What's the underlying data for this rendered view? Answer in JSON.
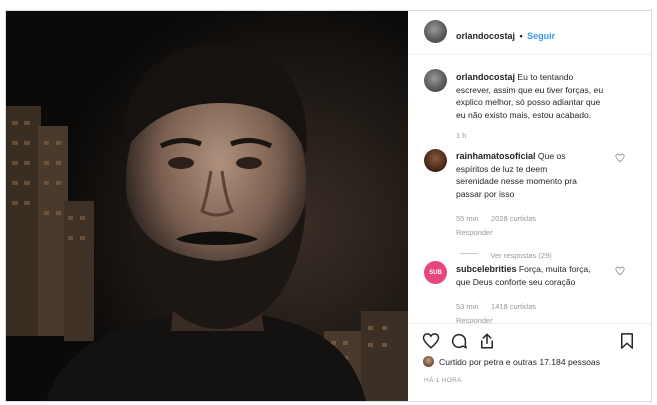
{
  "post": {
    "author": "orlandocostaj",
    "follow_label": "Seguir",
    "separator": "•"
  },
  "caption": {
    "author": "orlandocostaj",
    "text_lines": [
      "Eu to tentando",
      "escrever, assim que eu tiver forças, eu",
      "explico melhor, só posso adiantar que",
      "eu não existo mais, estou acabado."
    ],
    "time": "1 h"
  },
  "comments": [
    {
      "author": "rainhamatosoficial",
      "text_lines": [
        "Que os",
        "espíritos de luz te deem",
        "serenidade nesse momento pra",
        "passar por isso"
      ],
      "time": "55 min",
      "likes": "2028 curtidas",
      "reply": "Responder",
      "view_replies": "Ver respostas (29)",
      "avatar_bg": "#4a2a1a"
    },
    {
      "author": "subcelebrities",
      "text_lines": [
        "Força, muita força,",
        "que Deus conforte seu coração"
      ],
      "time": "53 min",
      "likes": "1418 curtidas",
      "reply": "Responder",
      "avatar_bg": "#e8457a",
      "avatar_text": "SUB"
    }
  ],
  "footer": {
    "liked_by_prefix": "Curtido por",
    "liked_by_user": "petra",
    "liked_by_suffix": "e outras 17.184 pessoas",
    "timestamp": "HÁ 1 HORA"
  },
  "icons": [
    "heart-icon",
    "comment-icon",
    "share-icon",
    "bookmark-icon"
  ]
}
